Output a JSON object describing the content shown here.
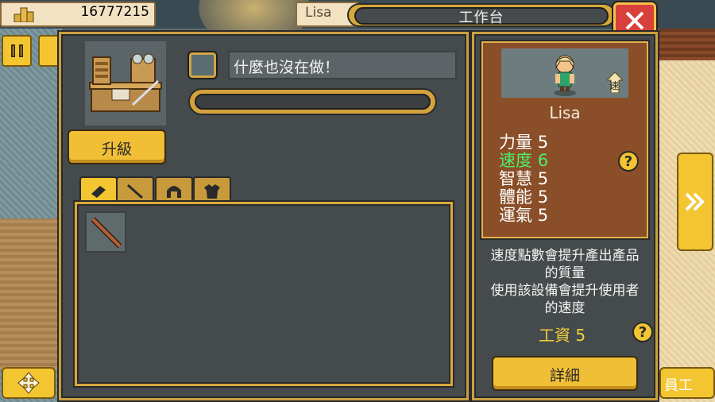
{
  "top_bar": {
    "coins": "16777215",
    "character_name_tab": "Lisa",
    "window_title": "工作台"
  },
  "workbench": {
    "upgrade_label": "升級",
    "status_text": "什麼也沒在做！",
    "progress": 0,
    "tabs": [
      {
        "icon": "whetstone-icon"
      },
      {
        "icon": "staff-icon"
      },
      {
        "icon": "helmet-icon"
      },
      {
        "icon": "armor-icon"
      }
    ],
    "inventory_items": [
      {
        "icon": "wooden-staff-icon"
      }
    ]
  },
  "character": {
    "name": "Lisa",
    "speech_bubble": "速",
    "stats": [
      {
        "label": "力量",
        "value": "5",
        "highlight": false
      },
      {
        "label": "速度",
        "value": "6",
        "highlight": true
      },
      {
        "label": "智慧",
        "value": "5",
        "highlight": false
      },
      {
        "label": "體能",
        "value": "5",
        "highlight": false
      },
      {
        "label": "運氣",
        "value": "5",
        "highlight": false
      }
    ],
    "description_1": [
      "速度點數會提升產出產品",
      "的質量"
    ],
    "description_2": [
      "使用該設備會提升使用者",
      "的速度"
    ],
    "wage": "工資 5",
    "details_label": "詳細",
    "help_label": "?"
  },
  "side_buttons": {
    "employee_label": "員工"
  },
  "colors": {
    "gold": "#f2c531",
    "panel": "#454a4d",
    "close_red": "#d8403b",
    "highlight_green": "#4cf06a",
    "wage_yellow": "#f2d03c"
  }
}
